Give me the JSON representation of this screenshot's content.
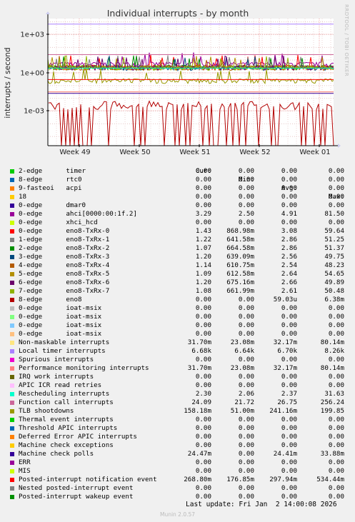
{
  "chart_data": {
    "type": "line",
    "title": "Individual interrupts - by month",
    "ylabel": "interrupts / second",
    "yscale": "log",
    "yticks": [
      "1e+03",
      "1e+00",
      "1e-03"
    ],
    "xticks": [
      "Week 49",
      "Week 50",
      "Week 51",
      "Week 52",
      "Week 01"
    ],
    "side_label": "RRDTOOL / TOBI OETIKER",
    "columns": [
      "Cur:",
      "Min:",
      "Avg:",
      "Max:"
    ],
    "series": [
      {
        "label": "2-edge      timer",
        "color": "#00cc00",
        "cur": "0.00",
        "min": "0.00",
        "avg": "0.00",
        "max": "0.00"
      },
      {
        "label": "8-edge      rtc0",
        "color": "#0066b3",
        "cur": "0.00",
        "min": "0.00",
        "avg": "0.00",
        "max": "0.00"
      },
      {
        "label": "9-fasteoi   acpi",
        "color": "#ff8000",
        "cur": "0.00",
        "min": "0.00",
        "avg": "0.00",
        "max": "0.00"
      },
      {
        "label": "18",
        "color": "#ffcc00",
        "cur": "0.00",
        "min": "0.00",
        "avg": "0.00",
        "max": "0.00"
      },
      {
        "label": "0-edge      dmar0",
        "color": "#330099",
        "cur": "0.00",
        "min": "0.00",
        "avg": "0.00",
        "max": "0.00"
      },
      {
        "label": "0-edge      ahci[0000:00:1f.2]",
        "color": "#990099",
        "cur": "3.29",
        "min": "2.50",
        "avg": "4.91",
        "max": "81.50"
      },
      {
        "label": "0-edge      xhci_hcd",
        "color": "#ccff00",
        "cur": "0.00",
        "min": "0.00",
        "avg": "0.00",
        "max": "0.00"
      },
      {
        "label": "0-edge      eno8-TxRx-0",
        "color": "#ff0000",
        "cur": "1.43",
        "min": "868.98m",
        "avg": "3.08",
        "max": "59.64"
      },
      {
        "label": "1-edge      eno8-TxRx-1",
        "color": "#808080",
        "cur": "1.22",
        "min": "641.58m",
        "avg": "2.86",
        "max": "51.25"
      },
      {
        "label": "2-edge      eno8-TxRx-2",
        "color": "#008f00",
        "cur": "1.07",
        "min": "664.58m",
        "avg": "2.86",
        "max": "51.37"
      },
      {
        "label": "3-edge      eno8-TxRx-3",
        "color": "#00487d",
        "cur": "1.20",
        "min": "639.09m",
        "avg": "2.56",
        "max": "49.75"
      },
      {
        "label": "4-edge      eno8-TxRx-4",
        "color": "#b35a00",
        "cur": "1.14",
        "min": "610.75m",
        "avg": "2.54",
        "max": "48.23"
      },
      {
        "label": "5-edge      eno8-TxRx-5",
        "color": "#b38f00",
        "cur": "1.09",
        "min": "612.58m",
        "avg": "2.64",
        "max": "54.65"
      },
      {
        "label": "6-edge      eno8-TxRx-6",
        "color": "#6b006b",
        "cur": "1.20",
        "min": "675.16m",
        "avg": "2.66",
        "max": "49.89"
      },
      {
        "label": "7-edge      eno8-TxRx-7",
        "color": "#8fb300",
        "cur": "1.08",
        "min": "661.99m",
        "avg": "2.61",
        "max": "50.48"
      },
      {
        "label": "8-edge      eno8",
        "color": "#b30000",
        "cur": "0.00",
        "min": "0.00",
        "avg": "59.03u",
        "max": "6.38m"
      },
      {
        "label": "0-edge      ioat-msix",
        "color": "#bebebe",
        "cur": "0.00",
        "min": "0.00",
        "avg": "0.00",
        "max": "0.00"
      },
      {
        "label": "0-edge      ioat-msix",
        "color": "#80ff80",
        "cur": "0.00",
        "min": "0.00",
        "avg": "0.00",
        "max": "0.00"
      },
      {
        "label": "0-edge      ioat-msix",
        "color": "#80c9ff",
        "cur": "0.00",
        "min": "0.00",
        "avg": "0.00",
        "max": "0.00"
      },
      {
        "label": "0-edge      ioat-msix",
        "color": "#ffc080",
        "cur": "0.00",
        "min": "0.00",
        "avg": "0.00",
        "max": "0.00"
      },
      {
        "label": "Non-maskable interrupts",
        "color": "#ffe680",
        "cur": "31.70m",
        "min": "23.08m",
        "avg": "32.17m",
        "max": "80.14m"
      },
      {
        "label": "Local timer interrupts",
        "color": "#aa80ff",
        "cur": "6.68k",
        "min": "6.64k",
        "avg": "6.70k",
        "max": "8.26k"
      },
      {
        "label": "Spurious interrupts",
        "color": "#ee00cc",
        "cur": "0.00",
        "min": "0.00",
        "avg": "0.00",
        "max": "0.00"
      },
      {
        "label": "Performance monitoring interrupts",
        "color": "#ff8080",
        "cur": "31.70m",
        "min": "23.08m",
        "avg": "32.17m",
        "max": "80.14m"
      },
      {
        "label": "IRQ work interrupts",
        "color": "#666600",
        "cur": "0.00",
        "min": "0.00",
        "avg": "0.00",
        "max": "0.00"
      },
      {
        "label": "APIC ICR read retries",
        "color": "#ffbfff",
        "cur": "0.00",
        "min": "0.00",
        "avg": "0.00",
        "max": "0.00"
      },
      {
        "label": "Rescheduling interrupts",
        "color": "#00ffcc",
        "cur": "2.30",
        "min": "2.06",
        "avg": "2.37",
        "max": "31.63"
      },
      {
        "label": "Function call interrupts",
        "color": "#cc6699",
        "cur": "24.09",
        "min": "21.72",
        "avg": "26.75",
        "max": "256.24"
      },
      {
        "label": "TLB shootdowns",
        "color": "#999900",
        "cur": "158.18m",
        "min": "51.00m",
        "avg": "241.16m",
        "max": "199.85"
      },
      {
        "label": "Thermal event interrupts",
        "color": "#00cc00",
        "cur": "0.00",
        "min": "0.00",
        "avg": "0.00",
        "max": "0.00"
      },
      {
        "label": "Threshold APIC interrupts",
        "color": "#0066b3",
        "cur": "0.00",
        "min": "0.00",
        "avg": "0.00",
        "max": "0.00"
      },
      {
        "label": "Deferred Error APIC interrupts",
        "color": "#ff8000",
        "cur": "0.00",
        "min": "0.00",
        "avg": "0.00",
        "max": "0.00"
      },
      {
        "label": "Machine check exceptions",
        "color": "#ffcc00",
        "cur": "0.00",
        "min": "0.00",
        "avg": "0.00",
        "max": "0.00"
      },
      {
        "label": "Machine check polls",
        "color": "#330099",
        "cur": "24.47m",
        "min": "0.00",
        "avg": "24.41m",
        "max": "33.88m"
      },
      {
        "label": "ERR",
        "color": "#990099",
        "cur": "0.00",
        "min": "0.00",
        "avg": "0.00",
        "max": "0.00"
      },
      {
        "label": "MIS",
        "color": "#ccff00",
        "cur": "0.00",
        "min": "0.00",
        "avg": "0.00",
        "max": "0.00"
      },
      {
        "label": "Posted-interrupt notification event",
        "color": "#ff0000",
        "cur": "268.80m",
        "min": "176.85m",
        "avg": "297.94m",
        "max": "534.44m"
      },
      {
        "label": "Nested posted-interrupt event",
        "color": "#808080",
        "cur": "0.00",
        "min": "0.00",
        "avg": "0.00",
        "max": "0.00"
      },
      {
        "label": "Posted-interrupt wakeup event",
        "color": "#008f00",
        "cur": "0.00",
        "min": "0.00",
        "avg": "0.00",
        "max": "0.00"
      }
    ]
  },
  "footer": {
    "last_update": "Last update: Fri Jan  2 14:00:08 2026",
    "generator": "Munin 2.0.57"
  }
}
